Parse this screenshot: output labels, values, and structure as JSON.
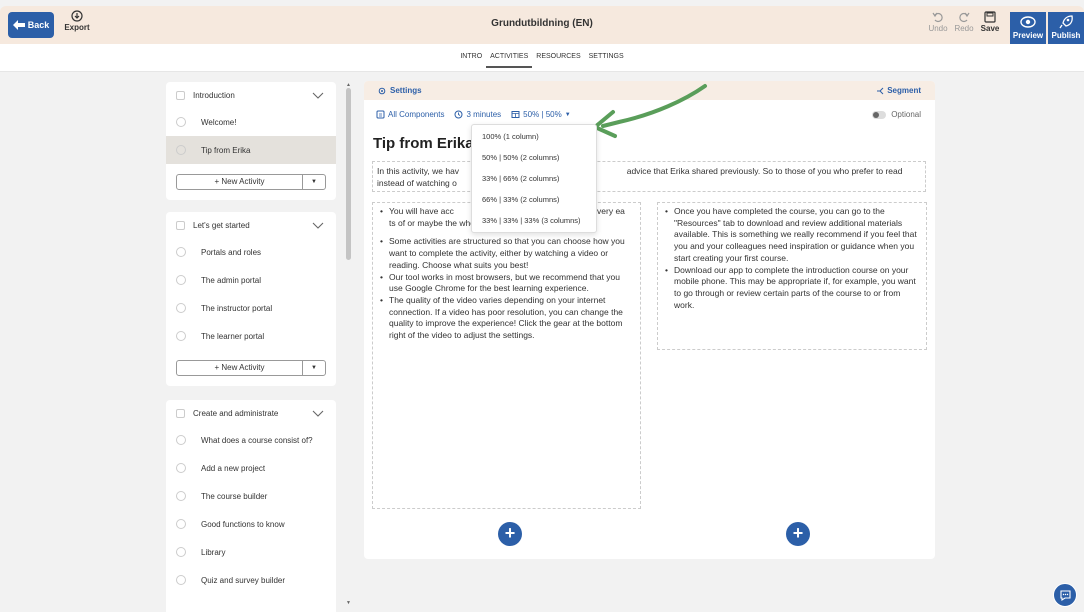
{
  "topbar": {
    "back_label": "Back",
    "export_label": "Export",
    "title": "Grundutbildning (EN)",
    "undo_label": "Undo",
    "redo_label": "Redo",
    "save_label": "Save",
    "preview_label": "Preview",
    "publish_label": "Publish"
  },
  "nav": {
    "tabs": [
      {
        "label": "INTRO"
      },
      {
        "label": "ACTIVITIES"
      },
      {
        "label": "RESOURCES"
      },
      {
        "label": "SETTINGS"
      }
    ],
    "active": "ACTIVITIES"
  },
  "sidebar": {
    "sections": [
      {
        "title": "Introduction",
        "items": [
          {
            "label": "Welcome!"
          },
          {
            "label": "Tip from Erika"
          }
        ],
        "new_activity_label": "+ New Activity"
      },
      {
        "title": "Let's get started",
        "items": [
          {
            "label": "Portals and roles"
          },
          {
            "label": "The admin portal"
          },
          {
            "label": "The instructor portal"
          },
          {
            "label": "The learner portal"
          }
        ],
        "new_activity_label": "+ New Activity"
      },
      {
        "title": "Create and administrate",
        "items": [
          {
            "label": "What does a course consist of?"
          },
          {
            "label": "Add a new project"
          },
          {
            "label": "The course builder"
          },
          {
            "label": "Good functions to know"
          },
          {
            "label": "Library"
          },
          {
            "label": "Quiz and survey builder"
          }
        ]
      }
    ],
    "active_item": "Tip from Erika"
  },
  "main": {
    "settings_label": "Settings",
    "segment_label": "Segment",
    "all_components_label": "All Components",
    "duration_label": "3 minutes",
    "layout_label": "50% | 50%",
    "optional_label": "Optional",
    "activity_title": "Tip from Erika",
    "intro_text": "In this activity, we hav                                                                       advice that Erika shared previously. So to those of you who prefer to read instead of watching o",
    "left_column": [
      "You will have acc                              e for one year. It is very ea                         ts of or maybe the whole course if you so wish.",
      "Some activities are structured so that you can choose how you want to complete the activity, either by watching a video or reading. Choose what suits you best!",
      "Our tool works in most browsers, but we recommend that you use Google Chrome for the best learning experience.",
      "The quality of the video varies depending on your internet connection. If a video has poor resolution, you can change the quality to improve the experience! Click the gear at the bottom right of the video to adjust the settings."
    ],
    "right_column": [
      "Once you have completed the course, you can go to the \"Resources\" tab to download and review additional materials available. This is something we really recommend if you feel that you and your colleagues need inspiration or guidance when you start creating your first course.",
      "Download our app to complete the introduction course on your mobile phone. This may be appropriate if, for example, you want to go through or review certain parts of the course to or from work."
    ]
  },
  "layout_dropdown": {
    "options": [
      {
        "label": "100% (1 column)"
      },
      {
        "label": "50% | 50% (2 columns)"
      },
      {
        "label": "33% | 66% (2 columns)"
      },
      {
        "label": "66% | 33% (2 columns)"
      },
      {
        "label": "33% | 33% | 33% (3 columns)"
      }
    ]
  },
  "colors": {
    "accent": "#2c5fa8",
    "header_bg": "#f6e9de",
    "annotation_arrow": "#5a9e5a"
  }
}
